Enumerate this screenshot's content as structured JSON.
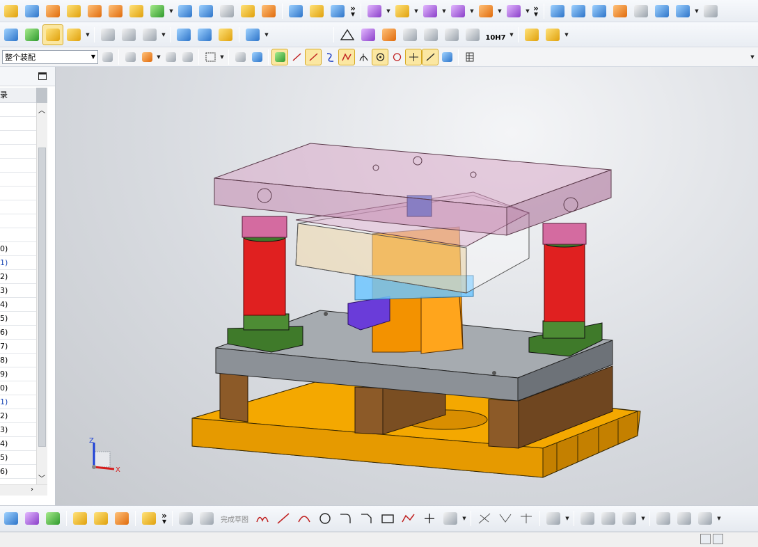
{
  "assembly_filter": {
    "selected": "整个装配"
  },
  "bottom_toolbar": {
    "finish_sketch_label": "完成草图"
  },
  "top_toolbar": {
    "fit_label": "10H7"
  },
  "navigator": {
    "header_partial": "录",
    "rows": [
      "",
      "",
      "",
      "",
      "",
      "",
      "",
      "",
      "",
      "",
      "0)",
      "1)",
      "2)",
      "3)",
      "4)",
      "5)",
      "6)",
      "7)",
      "8)",
      "9)",
      "0)",
      "1)",
      "2)",
      "3)",
      "4)",
      "5)",
      "6)"
    ]
  },
  "triad": {
    "z_label": "Z",
    "x_label": "X"
  },
  "icons": {
    "row1": [
      "new-part-icon",
      "open-part-icon",
      "save-part-icon",
      "extrude-icon",
      "pattern-icon",
      "array-icon",
      "unite-icon",
      "datum-icon",
      "block-icon",
      "surface-icon",
      "sheet-icon",
      "shell-icon",
      "offset-icon",
      "blend-icon",
      "trim-icon",
      "body-icon",
      "move-face-icon",
      "replace-face-icon",
      "delete-face-icon",
      "resize-icon",
      "mirror-icon",
      "wrap-icon",
      "freeform-icon",
      "studio-icon",
      "swoop-icon",
      "law-icon",
      "sweep-icon",
      "styled-icon"
    ],
    "row2": [
      "analysis-icon",
      "hammer-icon",
      "select-feature-icon",
      "text-icon",
      "curve-icon",
      "face-curve-icon",
      "hole-icon",
      "thread-icon",
      "spring-icon",
      "nut-icon",
      "tools-icon",
      "triangle-icon",
      "table-icon",
      "grid-icon",
      "sections-icon",
      "note-icon",
      "brush-icon",
      "dimension-icon",
      "fit-icon",
      "blocks-icon",
      "assembly-icon"
    ],
    "row3": [
      "constraint-icon",
      "arrow-snap-icon",
      "grid-snap-icon",
      "relation-icon",
      "sketch-icon",
      "filter-icon",
      "select-box-icon",
      "part-icon",
      "body-filter-icon",
      "point-snap-icon",
      "line-snap-icon",
      "end-snap-icon",
      "curve-snap-icon",
      "mid-snap-icon",
      "tangent-snap-icon",
      "center-snap-icon",
      "quad-snap-icon",
      "intersect-snap-icon",
      "perp-snap-icon",
      "view-icon",
      "layer-icon"
    ],
    "bottom": [
      "move-icon",
      "assembly-nav-icon",
      "constraint-bottom-icon",
      "add-component-icon",
      "pattern-comp-icon",
      "blocks-bottom-icon",
      "explode-icon",
      "image-icon",
      "sketch-task-icon",
      "finish-sketch-icon",
      "profile-icon",
      "line-icon",
      "arc-icon",
      "circle-icon",
      "fillet-icon",
      "chamfer-icon",
      "rectangle-icon",
      "polygon-icon",
      "point-icon",
      "studio-spline-icon",
      "trim-icon",
      "extend-icon",
      "corner-icon",
      "offset-curve-icon",
      "dim-icon",
      "mirror-curve-icon",
      "constraints-icon",
      "auto-constrain-icon",
      "show-constraints-icon",
      "convert-icon",
      "pattern-curve-icon"
    ]
  },
  "colors": {
    "base_plate": "#f4a800",
    "die_shoe": "#7a7f86",
    "riser": "#8c5a28",
    "bushing": "#e02020",
    "green_block": "#3f7a2a",
    "top_plate": "#d9a9c9",
    "punch": "#f39200",
    "slot_tool": "#6a3cd9",
    "strip": "#6fc6ff"
  }
}
